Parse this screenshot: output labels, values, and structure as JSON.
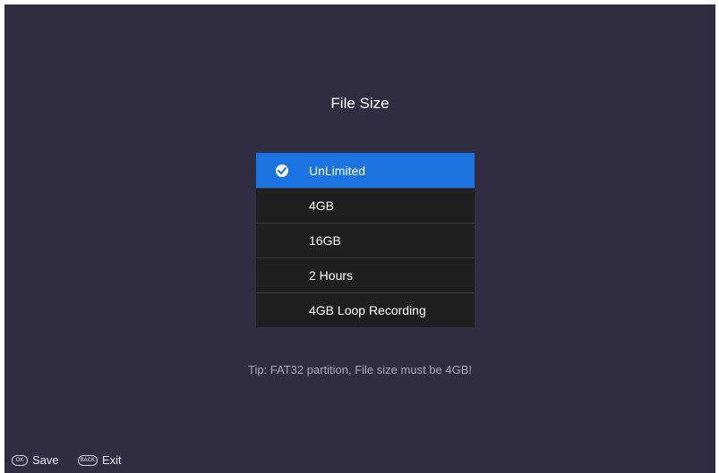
{
  "title": "File Size",
  "options": [
    {
      "label": "UnLimited",
      "selected": true
    },
    {
      "label": "4GB",
      "selected": false
    },
    {
      "label": "16GB",
      "selected": false
    },
    {
      "label": "2 Hours",
      "selected": false
    },
    {
      "label": "4GB Loop Recording",
      "selected": false
    }
  ],
  "tip": "Tip: FAT32 partition, File size must be 4GB!",
  "footer": {
    "save_key": "OK",
    "save_label": "Save",
    "exit_key": "BACK",
    "exit_label": "Exit"
  },
  "colors": {
    "background": "#302c42",
    "list_background": "#1f1f1f",
    "selected_accent": "#1a73e0",
    "tip_text": "#a9a8b3"
  },
  "icons": {
    "selected_marker": "check-circle-icon",
    "save_key": "ok-key-icon",
    "exit_key": "back-key-icon"
  }
}
